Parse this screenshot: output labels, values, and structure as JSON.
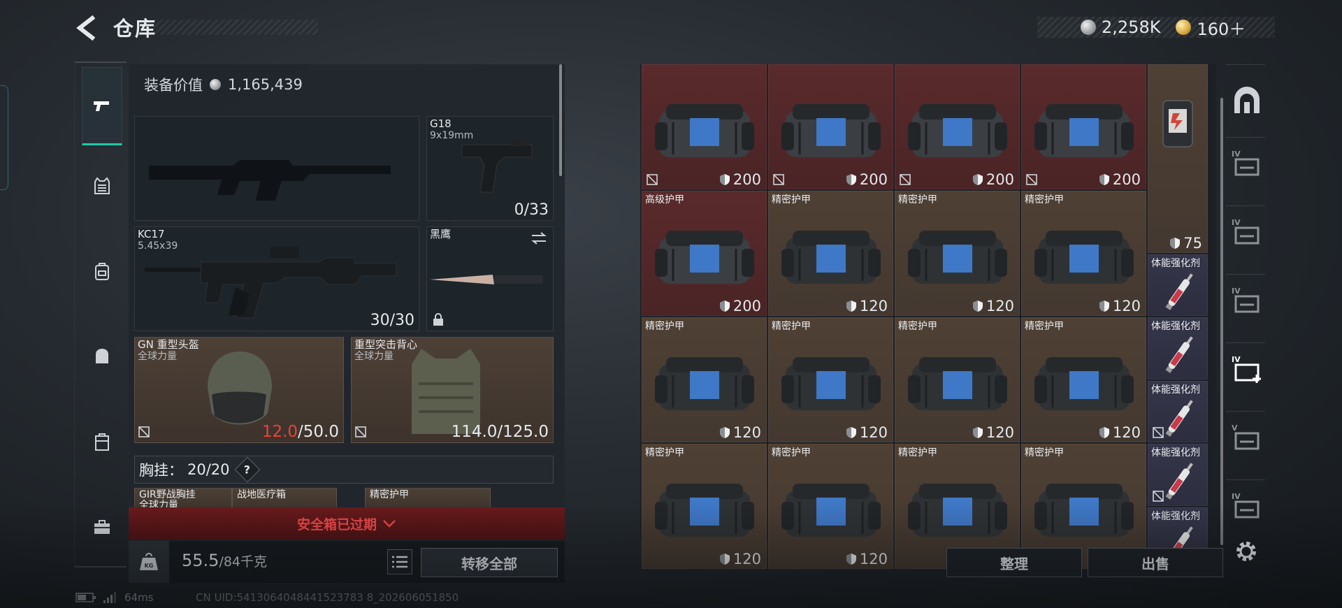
{
  "header": {
    "title": "仓库"
  },
  "currency": [
    {
      "icon": "silver-coin-icon",
      "value": "2,258K"
    },
    {
      "icon": "gold-coin-icon",
      "value": "160＋"
    }
  ],
  "equipment": {
    "value_label": "装备价值",
    "value": "1,165,439",
    "slots": {
      "primary_empty": {
        "name": ""
      },
      "secondary": {
        "name": "G18",
        "caliber": "9x19mm",
        "ammo": "0/33"
      },
      "primary": {
        "name": "KC17",
        "caliber": "5.45x39",
        "ammo": "30/30"
      },
      "melee": {
        "name": "黑鹰"
      },
      "helmet": {
        "name": "GN 重型头盔",
        "sub": "全球力量",
        "dur_current": "12.0",
        "dur_max": "/50.0"
      },
      "armor": {
        "name": "重型突击背心",
        "sub": "全球力量",
        "durability": "114.0/125.0"
      }
    },
    "chest_rig": {
      "label": "胸挂：",
      "value": "20/20",
      "help": "?"
    },
    "rig_items": [
      "GIR野战胸挂",
      "全球力量",
      "战地医疗箱",
      "精密护甲"
    ],
    "safebox_status": "安全箱已过期",
    "weight": {
      "value": "55.5",
      "max": "/84千克"
    },
    "transfer_all": "转移全部"
  },
  "stash": {
    "rows": [
      [
        {
          "label": "",
          "value": "200",
          "color": "red",
          "item": "bag-icon"
        },
        {
          "label": "",
          "value": "200",
          "color": "red",
          "item": "bag-icon"
        },
        {
          "label": "",
          "value": "200",
          "color": "red",
          "item": "bag-icon"
        },
        {
          "label": "",
          "value": "200",
          "color": "red",
          "item": "bag-icon"
        }
      ],
      [
        {
          "label": "高级护甲",
          "value": "200",
          "color": "red",
          "item": "bag-icon"
        },
        {
          "label": "精密护甲",
          "value": "120",
          "color": "brown",
          "item": "bag-icon"
        },
        {
          "label": "精密护甲",
          "value": "120",
          "color": "brown",
          "item": "bag-icon"
        },
        {
          "label": "精密护甲",
          "value": "120",
          "color": "brown",
          "item": "bag-icon"
        }
      ],
      [
        {
          "label": "精密护甲",
          "value": "120",
          "color": "brown",
          "item": "bag-icon"
        },
        {
          "label": "精密护甲",
          "value": "120",
          "color": "brown",
          "item": "bag-icon"
        },
        {
          "label": "精密护甲",
          "value": "120",
          "color": "brown",
          "item": "bag-icon"
        },
        {
          "label": "精密护甲",
          "value": "120",
          "color": "brown",
          "item": "bag-icon"
        }
      ],
      [
        {
          "label": "精密护甲",
          "value": "120",
          "color": "brown",
          "item": "bag-icon"
        },
        {
          "label": "精密护甲",
          "value": "120",
          "color": "brown",
          "item": "bag-icon"
        },
        {
          "label": "精密护甲",
          "value": "120",
          "color": "brown",
          "item": "bag-icon"
        },
        {
          "label": "精密护甲",
          "value": "120",
          "color": "brown",
          "item": "bag-icon"
        }
      ]
    ],
    "side_column": [
      {
        "label": "",
        "value": "75",
        "item": "device-icon"
      },
      {
        "label": "体能强化剂",
        "item": "syringe-icon"
      },
      {
        "label": "体能强化剂",
        "item": "syringe-icon"
      },
      {
        "label": "体能强化剂",
        "item": "syringe-icon"
      },
      {
        "label": "体能强化剂",
        "item": "syringe-icon"
      },
      {
        "label": "体能强化剂",
        "item": "syringe-icon"
      }
    ]
  },
  "buttons": {
    "sort": "整理",
    "sell": "出售"
  },
  "status": {
    "ping": "64ms",
    "uid": "CN UID:5413064048441523783 8_202606051850"
  },
  "rail_levels": [
    "IV",
    "IV",
    "IV",
    "IV",
    "V",
    "IV"
  ],
  "colors": {
    "accent": "#20c8a6",
    "danger": "#e8433b",
    "expired_bg": "#5a1618"
  }
}
